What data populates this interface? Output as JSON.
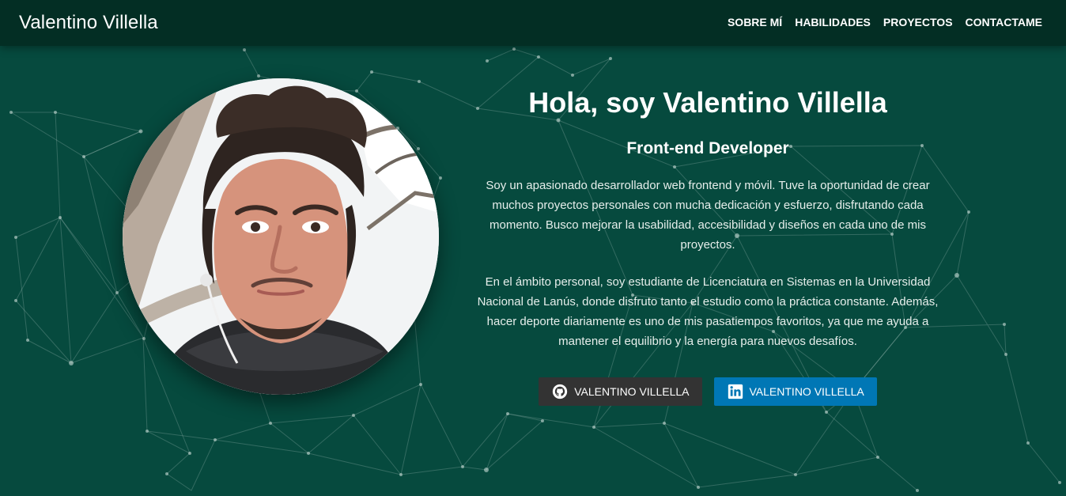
{
  "site": {
    "brand": "Valentino Villella",
    "nav": [
      {
        "label": "SOBRE MÍ"
      },
      {
        "label": "HABILIDADES"
      },
      {
        "label": "PROYECTOS"
      },
      {
        "label": "CONTACTAME"
      }
    ]
  },
  "hero": {
    "title": "Hola, soy Valentino Villella",
    "subtitle": "Front-end Developer",
    "paragraphs": [
      "Soy un apasionado desarrollador web frontend y móvil. Tuve la oportunidad de crear muchos proyectos personales con mucha dedicación y esfuerzo, disfrutando cada momento. Busco mejorar la usabilidad, accesibilidad y diseños en cada uno de mis proyectos.",
      "En el ámbito personal, soy estudiante de Licenciatura en Sistemas en la Universidad Nacional de Lanús, donde disfruto tanto el estudio como la práctica constante. Además, hacer deporte diariamente es uno de mis pasatiempos favoritos, ya que me ayuda a mantener el equilibrio y la energía para nuevos desafíos."
    ],
    "buttons": {
      "github": {
        "label": "VALENTINO VILLELLA",
        "icon": "github-icon"
      },
      "linkedin": {
        "label": "VALENTINO VILLELLA",
        "icon": "linkedin-icon"
      }
    }
  },
  "colors": {
    "background": "#064a3e",
    "navbar": "#032e24",
    "github_button": "#333333",
    "linkedin_button": "#0077b5",
    "text": "#ffffff"
  }
}
